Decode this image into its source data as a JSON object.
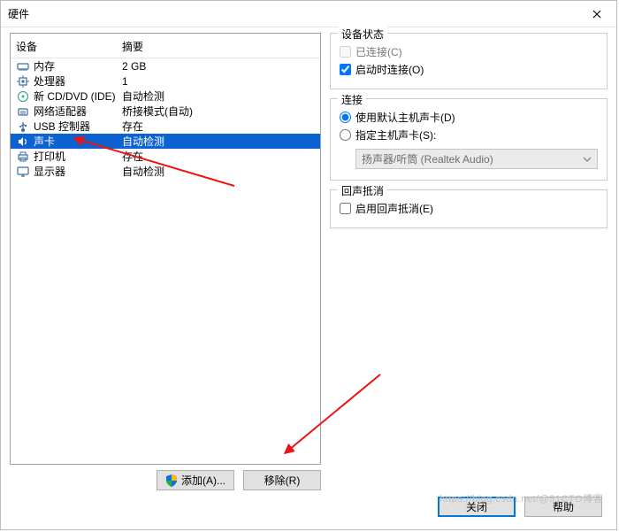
{
  "window": {
    "title": "硬件"
  },
  "columns": {
    "device": "设备",
    "summary": "摘要"
  },
  "devices": [
    {
      "icon": "memory",
      "name": "内存",
      "summary": "2 GB",
      "selected": false
    },
    {
      "icon": "cpu",
      "name": "处理器",
      "summary": "1",
      "selected": false
    },
    {
      "icon": "disc",
      "name": "新 CD/DVD (IDE)",
      "summary": "自动检测",
      "selected": false
    },
    {
      "icon": "network",
      "name": "网络适配器",
      "summary": "桥接模式(自动)",
      "selected": false
    },
    {
      "icon": "usb",
      "name": "USB 控制器",
      "summary": "存在",
      "selected": false
    },
    {
      "icon": "sound",
      "name": "声卡",
      "summary": "自动检测",
      "selected": true
    },
    {
      "icon": "printer",
      "name": "打印机",
      "summary": "存在",
      "selected": false
    },
    {
      "icon": "display",
      "name": "显示器",
      "summary": "自动检测",
      "selected": false
    }
  ],
  "buttons": {
    "add": "添加(A)...",
    "remove": "移除(R)",
    "close": "关闭",
    "help": "帮助"
  },
  "groups": {
    "status": {
      "legend": "设备状态",
      "connected": "已连接(C)",
      "connect_on_boot": "启动时连接(O)"
    },
    "connection": {
      "legend": "连接",
      "use_default": "使用默认主机声卡(D)",
      "specify": "指定主机声卡(S):",
      "combo_value": "扬声器/听筒 (Realtek Audio)"
    },
    "echo": {
      "legend": "回声抵消",
      "enable": "启用回声抵消(E)"
    }
  },
  "watermark": "https://blog.csdn.net/@51CTO博客"
}
